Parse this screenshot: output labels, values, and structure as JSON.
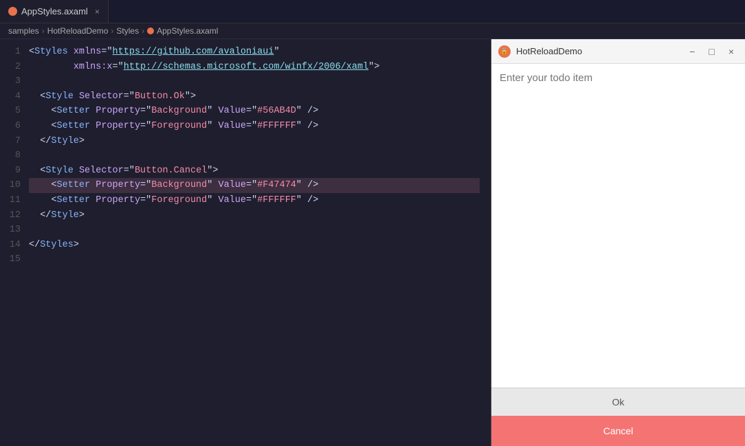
{
  "tab": {
    "filename": "AppStyles.axaml",
    "close_label": "×"
  },
  "breadcrumb": {
    "parts": [
      "samples",
      "HotReloadDemo",
      "Styles",
      "AppStyles.axaml"
    ]
  },
  "code": {
    "lines": [
      {
        "num": 1,
        "content": "<Styles xmlns=\"https://github.com/avaloniaui\"",
        "highlighted": false
      },
      {
        "num": 2,
        "content": "        xmlns:x=\"http://schemas.microsoft.com/winfx/2006/xaml\">",
        "highlighted": false
      },
      {
        "num": 3,
        "content": "",
        "highlighted": false
      },
      {
        "num": 4,
        "content": "  <Style Selector=\"Button.Ok\">",
        "highlighted": false
      },
      {
        "num": 5,
        "content": "    <Setter Property=\"Background\" Value=\"#56AB4D\" />",
        "highlighted": false
      },
      {
        "num": 6,
        "content": "    <Setter Property=\"Foreground\" Value=\"#FFFFFF\" />",
        "highlighted": false
      },
      {
        "num": 7,
        "content": "  </Style>",
        "highlighted": false
      },
      {
        "num": 8,
        "content": "",
        "highlighted": false
      },
      {
        "num": 9,
        "content": "  <Style Selector=\"Button.Cancel\">",
        "highlighted": false
      },
      {
        "num": 10,
        "content": "    <Setter Property=\"Background\" Value=\"#F47474\" />",
        "highlighted": true
      },
      {
        "num": 11,
        "content": "    <Setter Property=\"Foreground\" Value=\"#FFFFFF\" />",
        "highlighted": false
      },
      {
        "num": 12,
        "content": "  </Style>",
        "highlighted": false
      },
      {
        "num": 13,
        "content": "",
        "highlighted": false
      },
      {
        "num": 14,
        "content": "</Styles>",
        "highlighted": false
      },
      {
        "num": 15,
        "content": "",
        "highlighted": false
      }
    ]
  },
  "preview": {
    "title": "HotReloadDemo",
    "minimize_label": "−",
    "maximize_label": "□",
    "close_label": "×",
    "input_placeholder": "Enter your todo item",
    "ok_label": "Ok",
    "cancel_label": "Cancel"
  }
}
